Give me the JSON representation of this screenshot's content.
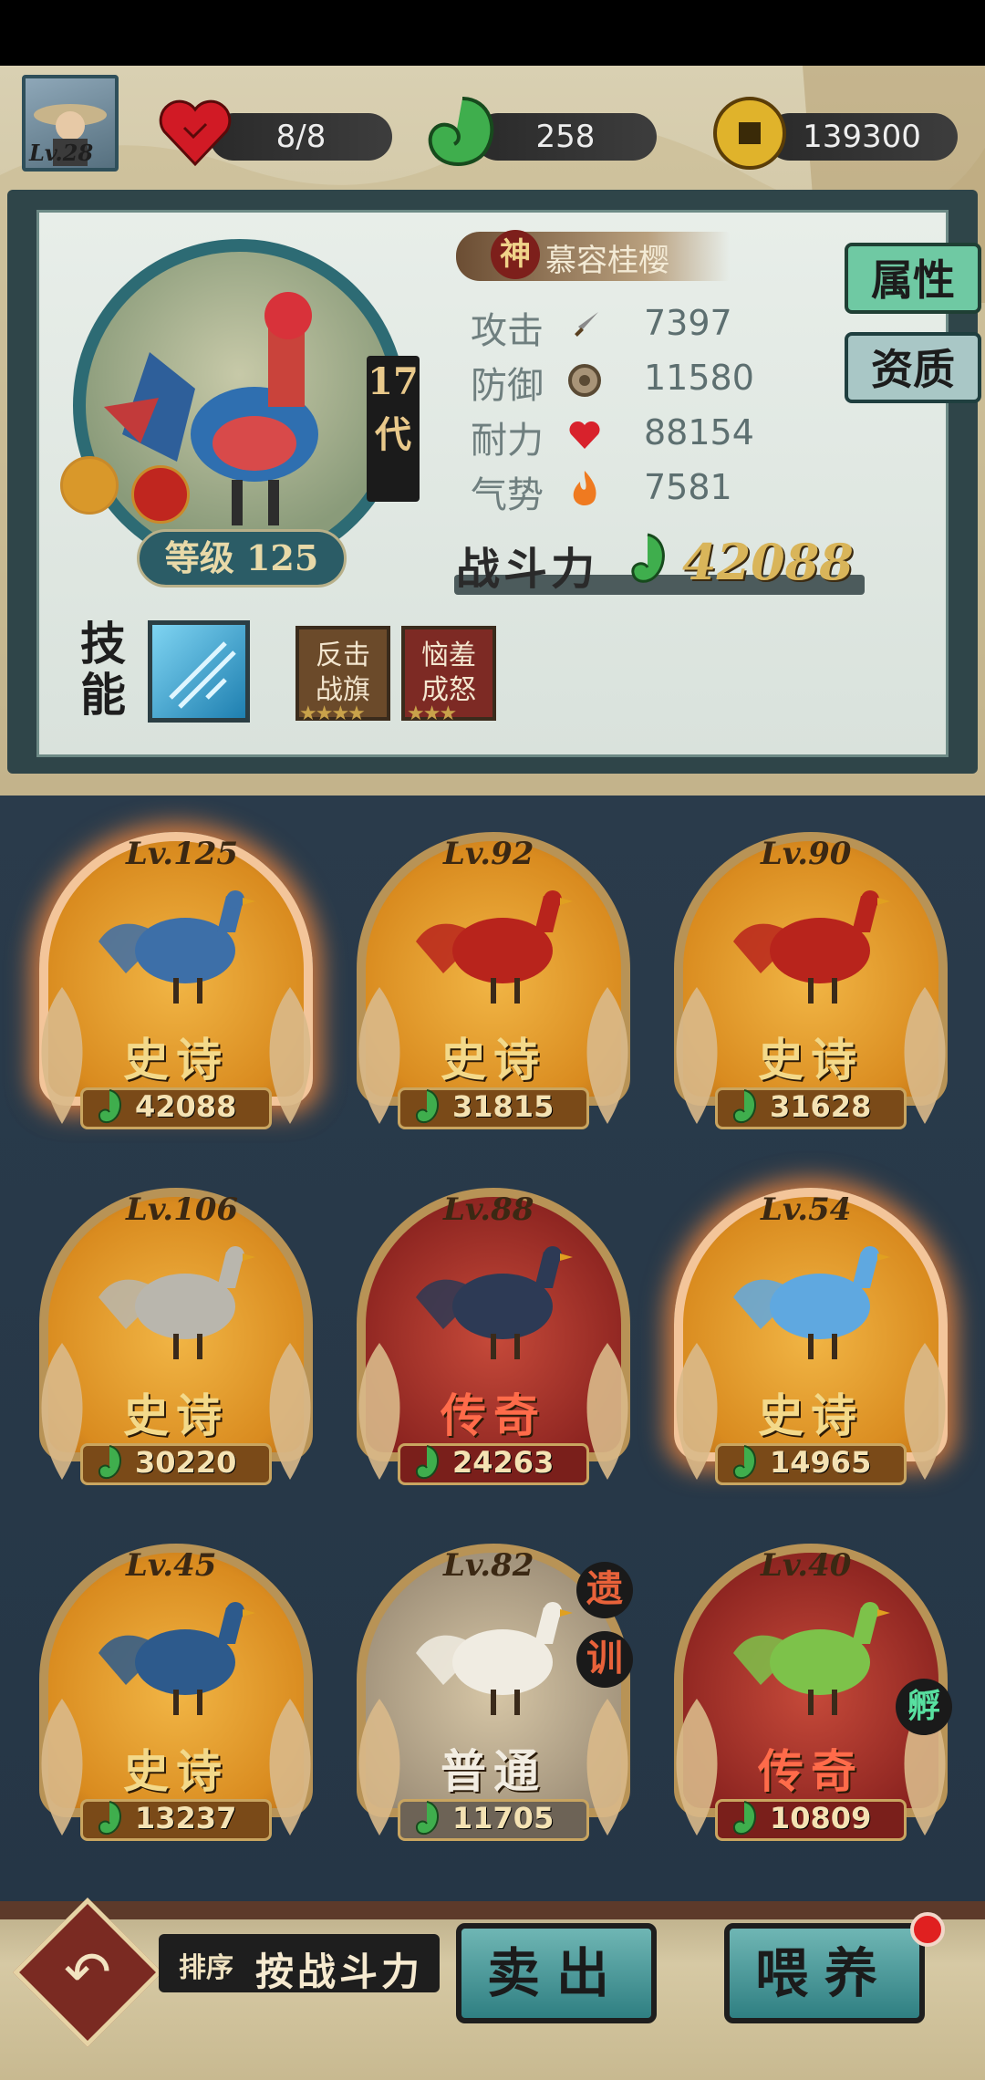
{
  "player": {
    "level_label": "Lv.28"
  },
  "resources": {
    "stamina": "8/8",
    "jade": "258",
    "coins": "139300"
  },
  "detail": {
    "rank_badge": "神",
    "name": "慕容桂樱",
    "generation": [
      "17",
      "代"
    ],
    "level_label": "等级 125",
    "stats": [
      {
        "label": "攻击",
        "icon": "sword-icon",
        "value": "7397"
      },
      {
        "label": "防御",
        "icon": "shield-icon",
        "value": "11580"
      },
      {
        "label": "耐力",
        "icon": "heart-icon",
        "value": "88154"
      },
      {
        "label": "气势",
        "icon": "flame-icon",
        "value": "7581"
      }
    ],
    "power_label": "战斗力",
    "power_value": "42088",
    "tabs": {
      "attributes": "属性",
      "aptitude": "资质"
    },
    "skills_label": "技能",
    "skill_cards": [
      {
        "text": [
          "反击",
          "战旗"
        ],
        "stars": "★★★★",
        "color": "#6b4a2a"
      },
      {
        "text": [
          "恼羞",
          "成怒"
        ],
        "stars": "★★★",
        "color": "#7d2a24"
      }
    ]
  },
  "roster": [
    {
      "level": "Lv.125",
      "rarity": "史诗",
      "power": "42088",
      "tier": "gold",
      "glow": true,
      "bird_color": "#3d6fa8"
    },
    {
      "level": "Lv.92",
      "rarity": "史诗",
      "power": "31815",
      "tier": "gold",
      "glow": false,
      "bird_color": "#b8241c"
    },
    {
      "level": "Lv.90",
      "rarity": "史诗",
      "power": "31628",
      "tier": "gold",
      "glow": false,
      "bird_color": "#b8241c"
    },
    {
      "level": "Lv.106",
      "rarity": "史诗",
      "power": "30220",
      "tier": "gold",
      "glow": false,
      "bird_color": "#b9b6ad"
    },
    {
      "level": "Lv.88",
      "rarity": "传奇",
      "power": "24263",
      "tier": "red",
      "glow": false,
      "bird_color": "#2d3a55"
    },
    {
      "level": "Lv.54",
      "rarity": "史诗",
      "power": "14965",
      "tier": "gold",
      "glow": true,
      "bird_color": "#5fa8e0"
    },
    {
      "level": "Lv.45",
      "rarity": "史诗",
      "power": "13237",
      "tier": "gold",
      "glow": false,
      "bird_color": "#2d5a8c"
    },
    {
      "level": "Lv.82",
      "rarity": "普通",
      "power": "11705",
      "tier": "grey",
      "glow": false,
      "bird_color": "#f0ece2",
      "badges": [
        "遗",
        "训"
      ]
    },
    {
      "level": "Lv.40",
      "rarity": "传奇",
      "power": "10809",
      "tier": "red",
      "glow": false,
      "bird_color": "#7dc24a",
      "hatch_badge": "孵"
    }
  ],
  "bottom": {
    "sort_label": "排序",
    "sort_value": "按战斗力",
    "sell_label": "卖出",
    "feed_label": "喂养"
  },
  "colors": {
    "epic_text": "#f3d98a",
    "legend_text": "#ff6b4a",
    "common_text": "#f2ede2"
  }
}
